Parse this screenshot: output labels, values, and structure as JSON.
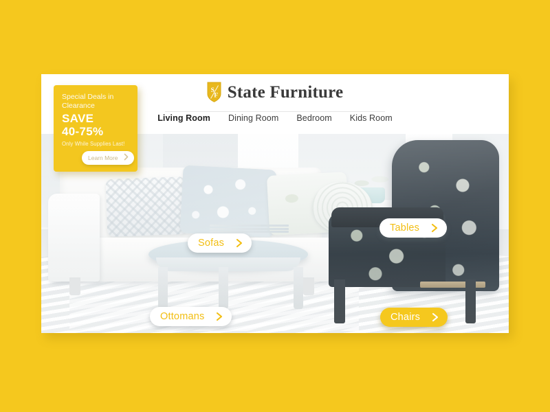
{
  "theme": {
    "brand_yellow": "#f5c81e",
    "promo_yellow": "#f3c71f",
    "pill_text_yellow": "#f2be12",
    "card_white": "#ffffff",
    "nav_text": "#3c3c3c"
  },
  "header": {
    "logo_icon": "shield-logo-icon",
    "logo_letters": {
      "first": "S",
      "second": "F"
    },
    "brand_name": "State Furniture",
    "nav": [
      {
        "label": "Living Room",
        "active": true
      },
      {
        "label": "Dining Room",
        "active": false
      },
      {
        "label": "Bedroom",
        "active": false
      },
      {
        "label": "Kids Room",
        "active": false
      }
    ]
  },
  "promo": {
    "title": "Special Deals in Clearance",
    "save_label": "SAVE",
    "amount": "40-75%",
    "note": "Only While Supplies Last!",
    "cta_label": "Learn More",
    "cta_icon": "chevron-right-icon"
  },
  "hero": {
    "scene_description": "living room with white sofa, light blue ottoman and dark floral wing chair",
    "hotspots": [
      {
        "label": "Sofas",
        "active": false,
        "icon": "chevron-right-icon"
      },
      {
        "label": "Tables",
        "active": false,
        "icon": "chevron-right-icon"
      },
      {
        "label": "Ottomans",
        "active": false,
        "icon": "chevron-right-icon"
      },
      {
        "label": "Chairs",
        "active": true,
        "icon": "chevron-right-icon"
      }
    ]
  }
}
